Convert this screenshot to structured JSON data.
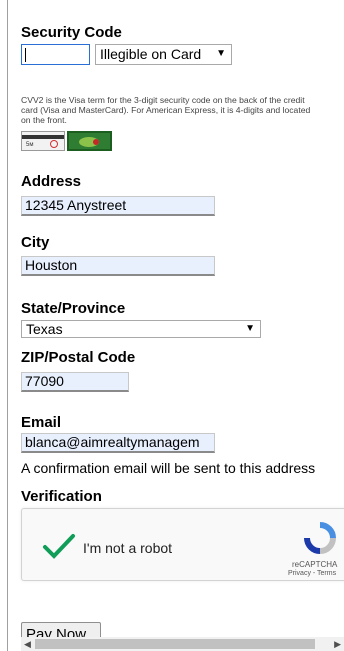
{
  "security": {
    "label": "Security Code",
    "value": "",
    "card_select": "Illegible on Card",
    "help": "CVV2 is the Visa term for the 3-digit security code on the back of the credit card (Visa and MasterCard). For American Express, it is 4-digits and located on the front."
  },
  "address": {
    "label": "Address",
    "value": "12345 Anystreet"
  },
  "city": {
    "label": "City",
    "value": "Houston"
  },
  "state": {
    "label": "State/Province",
    "value": "Texas"
  },
  "zip": {
    "label": "ZIP/Postal Code",
    "value": "77090"
  },
  "email": {
    "label": "Email",
    "value": "blanca@aimrealtymanagem",
    "note": "A confirmation email will be sent to this address"
  },
  "verification": {
    "label": "Verification",
    "checkbox_text": "I'm not a robot",
    "brand": "reCAPTCHA",
    "links": "Privacy - Terms"
  },
  "pay_button": "Pay Now",
  "colors": {
    "autofill": "#e8f0fe",
    "check": "#0f9d58",
    "focus": "#2a6fd6"
  }
}
